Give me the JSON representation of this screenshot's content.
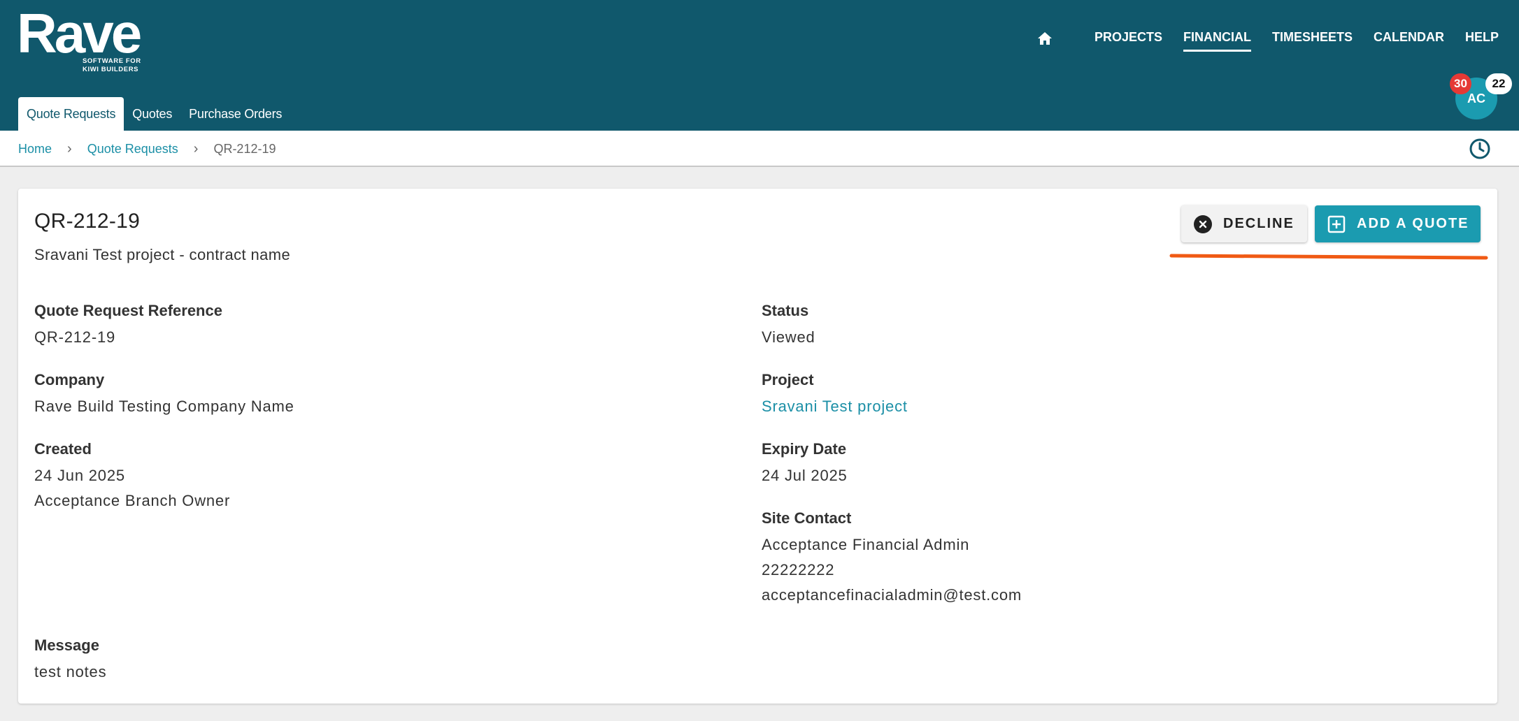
{
  "brand": {
    "name": "Rave",
    "tagline": "SOFTWARE FOR\nKIWI BUILDERS"
  },
  "nav": {
    "home_icon": "home-icon",
    "items": [
      "PROJECTS",
      "FINANCIAL",
      "TIMESHEETS",
      "CALENDAR",
      "HELP"
    ],
    "active": "FINANCIAL"
  },
  "tabs": [
    "Quote Requests",
    "Quotes",
    "Purchase Orders"
  ],
  "user": {
    "initials": "AC",
    "badge_red": "30",
    "badge_white": "22"
  },
  "breadcrumb": {
    "home": "Home",
    "section": "Quote Requests",
    "current": "QR-212-19",
    "separator": "›"
  },
  "header_card": {
    "title": "QR-212-19",
    "subtitle": "Sravani Test project - contract name",
    "decline_label": "DECLINE",
    "add_quote_label": "ADD A QUOTE"
  },
  "fields": {
    "reference": {
      "label": "Quote Request Reference",
      "value": "QR-212-19"
    },
    "company": {
      "label": "Company",
      "value": "Rave Build Testing Company Name"
    },
    "created": {
      "label": "Created",
      "date": "24 Jun 2025",
      "by": "Acceptance Branch Owner"
    },
    "status": {
      "label": "Status",
      "value": "Viewed"
    },
    "project": {
      "label": "Project",
      "value": "Sravani Test project"
    },
    "expiry": {
      "label": "Expiry Date",
      "value": "24 Jul 2025"
    },
    "site_contact": {
      "label": "Site Contact",
      "name": "Acceptance Financial Admin",
      "phone": "22222222",
      "email": "acceptancefinacialadmin@test.com"
    },
    "message": {
      "label": "Message",
      "value": "test notes"
    }
  },
  "colors": {
    "header_bg": "#10586c",
    "accent": "#1b9bb0",
    "link": "#1b8fa6",
    "badge_red": "#e53935",
    "annotation": "#f05a14"
  }
}
